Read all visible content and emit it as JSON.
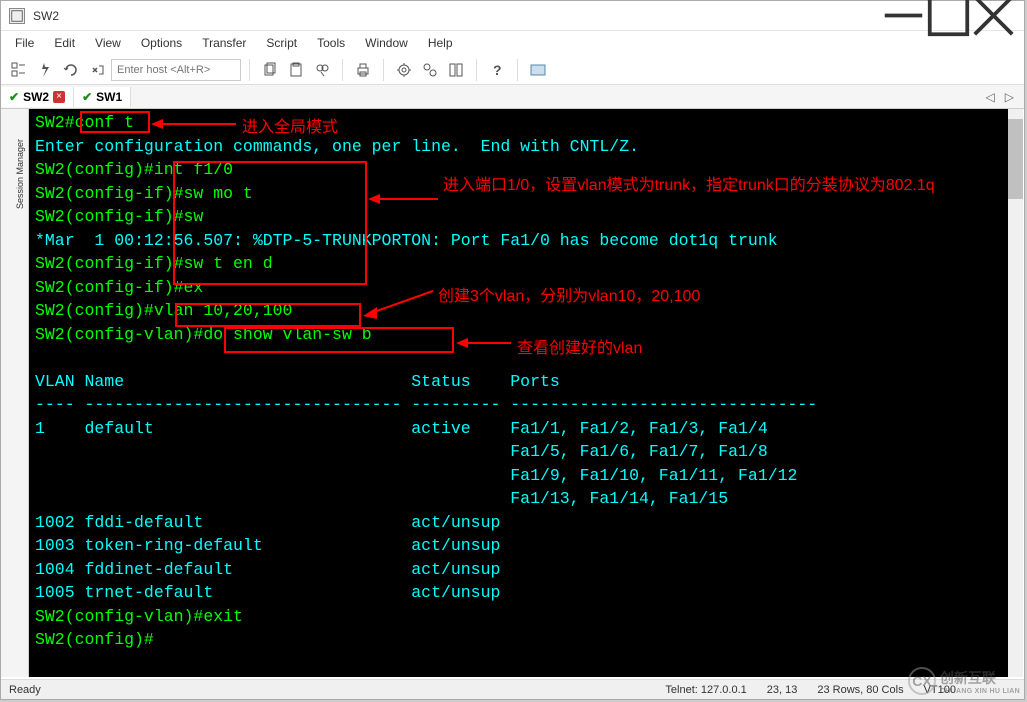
{
  "window": {
    "title": "SW2"
  },
  "menu": [
    "File",
    "Edit",
    "View",
    "Options",
    "Transfer",
    "Script",
    "Tools",
    "Window",
    "Help"
  ],
  "host_placeholder": "Enter host <Alt+R>",
  "tabs": [
    {
      "name": "SW2",
      "active": true,
      "has_close": true
    },
    {
      "name": "SW1",
      "active": false,
      "has_close": false
    }
  ],
  "session_mgr_label": "Session Manager",
  "terminal_lines": [
    "SW2#conf t",
    "Enter configuration commands, one per line.  End with CNTL/Z.",
    "SW2(config)#int f1/0",
    "SW2(config-if)#sw mo t",
    "SW2(config-if)#sw",
    "*Mar  1 00:12:56.507: %DTP-5-TRUNKPORTON: Port Fa1/0 has become dot1q trunk",
    "SW2(config-if)#sw t en d",
    "SW2(config-if)#ex",
    "SW2(config)#vlan 10,20,100",
    "SW2(config-vlan)#do show vlan-sw b",
    "",
    "VLAN Name                             Status    Ports",
    "---- -------------------------------- --------- -------------------------------",
    "1    default                          active    Fa1/1, Fa1/2, Fa1/3, Fa1/4",
    "                                                Fa1/5, Fa1/6, Fa1/7, Fa1/8",
    "                                                Fa1/9, Fa1/10, Fa1/11, Fa1/12",
    "                                                Fa1/13, Fa1/14, Fa1/15",
    "1002 fddi-default                     act/unsup",
    "1003 token-ring-default               act/unsup",
    "1004 fddinet-default                  act/unsup",
    "1005 trnet-default                    act/unsup",
    "SW2(config-vlan)#exit",
    "SW2(config)#"
  ],
  "annotations": {
    "a1": "进入全局模式",
    "a2": "进入端口1/0，设置vlan模式为trunk，指定trunk口的分装协议为802.1q",
    "a3": "创建3个vlan，分别为vlan10，20,100",
    "a4": "查看创建好的vlan"
  },
  "status": {
    "ready": "Ready",
    "conn": "Telnet: 127.0.0.1",
    "pos": "23,  13",
    "size": "23 Rows, 80 Cols",
    "term": "VT100"
  },
  "watermark": {
    "brand": "创新互联",
    "sub": "CHUANG XIN HU LIAN"
  }
}
